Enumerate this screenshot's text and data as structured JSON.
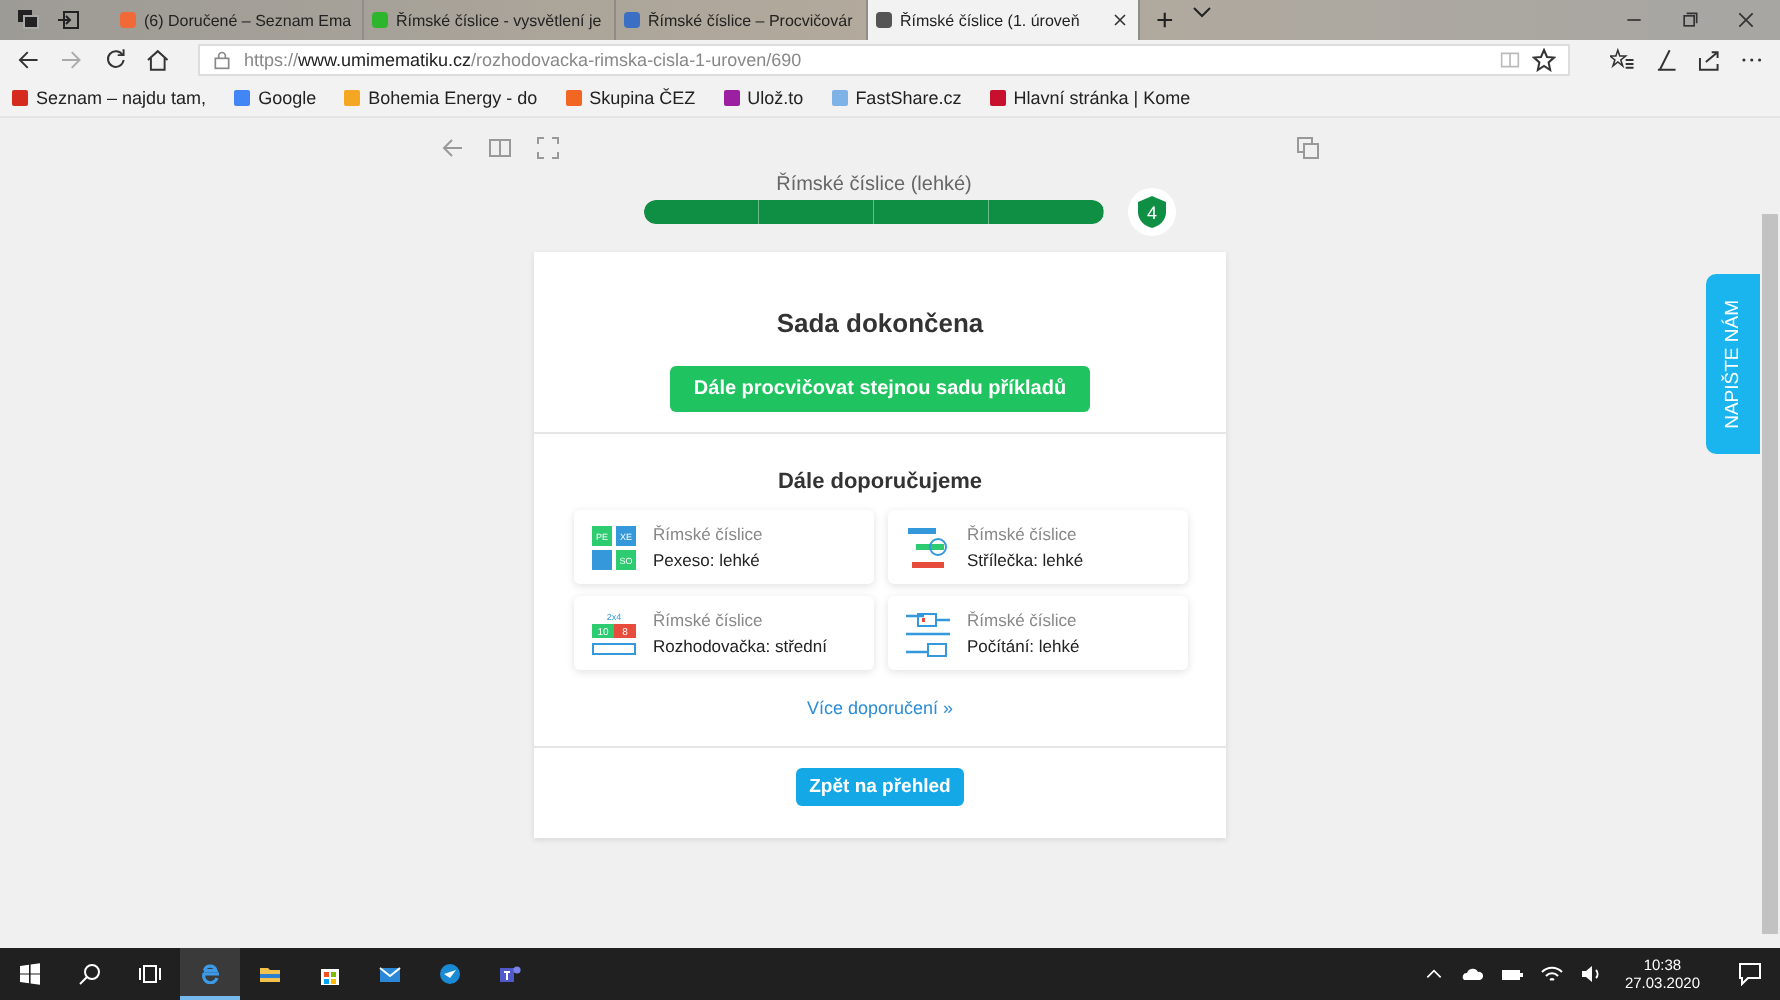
{
  "browser": {
    "tabs": [
      {
        "title": "(6) Doručené – Seznam Ema",
        "selected": false,
        "color": "#f06a35"
      },
      {
        "title": "Římské číslice - vysvětlení je",
        "selected": false,
        "color": "#2db52d"
      },
      {
        "title": "Římské číslice – Procvičovár",
        "selected": false,
        "color": "#3a6fc4"
      },
      {
        "title": "Římské číslice (1. úroveň",
        "selected": true,
        "color": "#555555"
      }
    ],
    "new_tab": "+",
    "url": "https://**www.umimematiku.cz**/rozhodovacka-rimska-cisla-1-uroven/690",
    "bookmarks": [
      {
        "label": "Seznam – najdu tam,",
        "color": "#d52b1e"
      },
      {
        "label": "Google",
        "color": "#4285f4"
      },
      {
        "label": "Bohemia Energy - do",
        "color": "#f5a623"
      },
      {
        "label": "Skupina ČEZ",
        "color": "#f26522"
      },
      {
        "label": "Ulož.to",
        "color": "#9b1fa0"
      },
      {
        "label": "FastShare.cz",
        "color": "#7fb3e8"
      },
      {
        "label": "Hlavní stránka | Kome",
        "color": "#c8102e"
      }
    ]
  },
  "page": {
    "progress": {
      "title": "Římské číslice (lehké)",
      "level": 1,
      "badge": "4"
    },
    "card": {
      "heading": "Sada dokončena",
      "repeat_button": "Dále procvičovat stejnou sadu příkladů",
      "recommend_heading": "Dále doporučujeme",
      "tiles": [
        {
          "kind": "pexeso",
          "topic": "Římské číslice",
          "name": "Pexeso: lehké",
          "icon_texts": [
            "PE",
            "XE",
            "SO"
          ]
        },
        {
          "kind": "strilecka",
          "topic": "Římské číslice",
          "name": "Střílečka: lehké"
        },
        {
          "kind": "rozhodovacka",
          "topic": "Římské číslice",
          "name": "Rozhodovačka: střední",
          "icon_texts": [
            "2x4",
            "10",
            "8"
          ]
        },
        {
          "kind": "pocitani",
          "topic": "Římské číslice",
          "name": "Počítání: lehké"
        }
      ],
      "more_link": "Více doporučení  »",
      "back_button": "Zpět na přehled"
    },
    "feedback_tab": "NAPIŠTE NÁM"
  },
  "taskbar": {
    "time": "10:38",
    "date": "27.03.2020"
  }
}
